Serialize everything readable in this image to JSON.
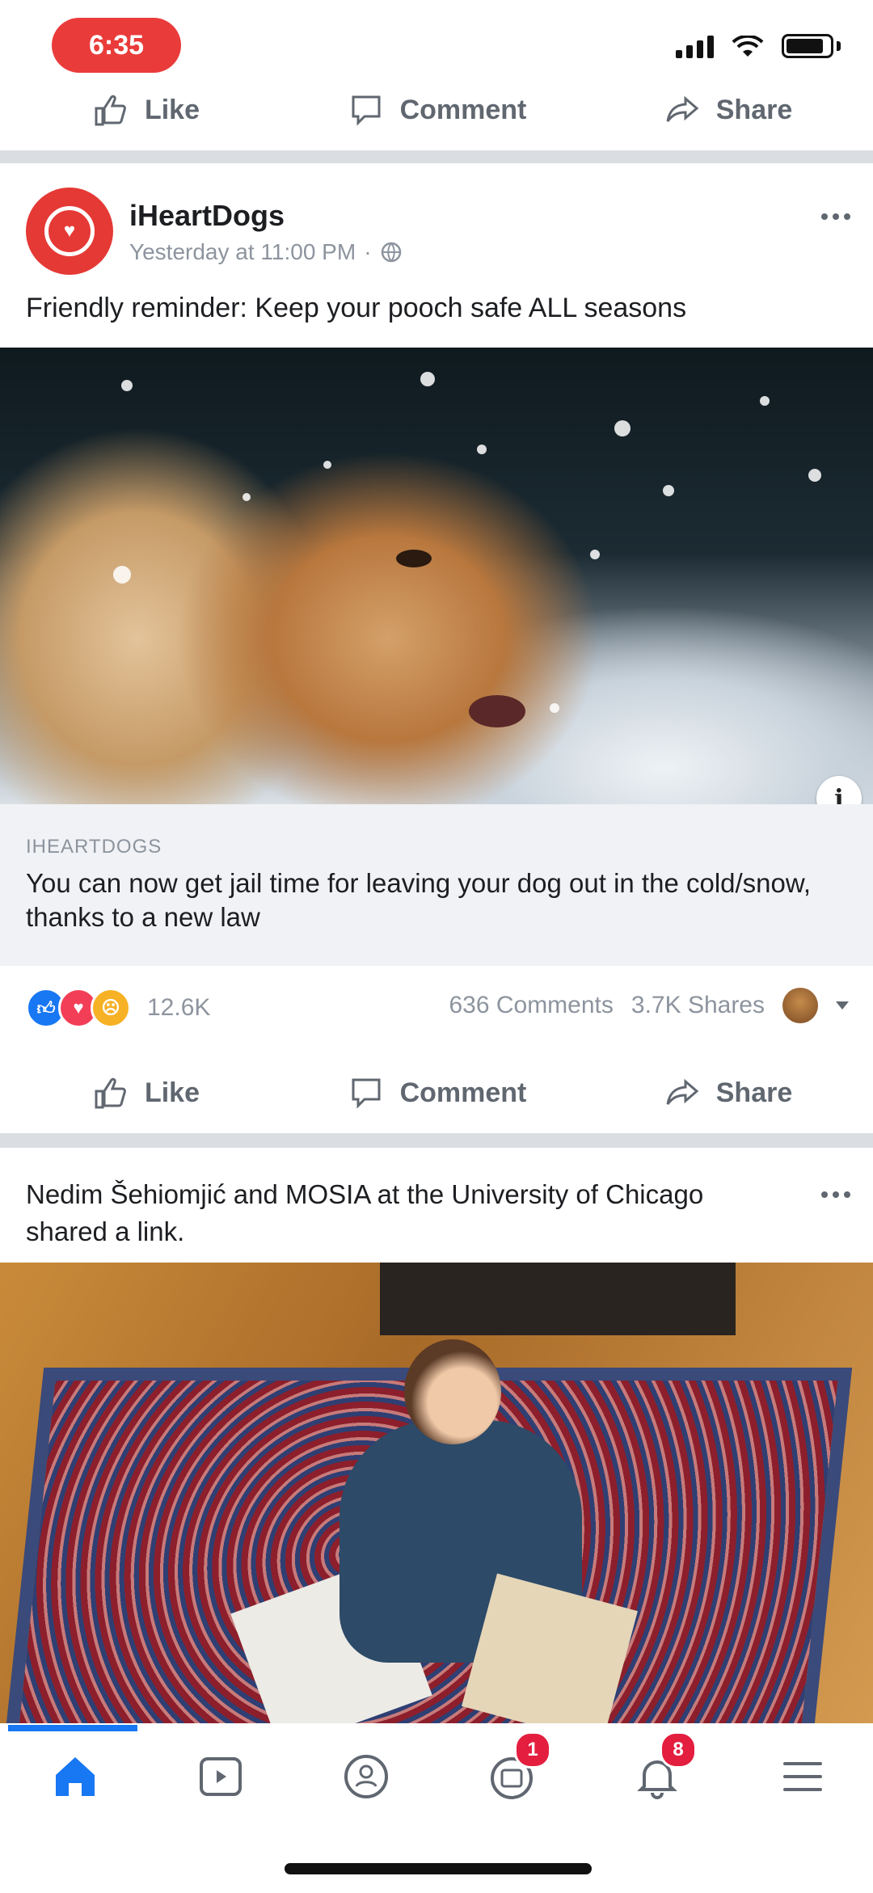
{
  "status_bar": {
    "time": "6:35"
  },
  "top_actions": {
    "like": "Like",
    "comment": "Comment",
    "share": "Share"
  },
  "post1": {
    "author": "iHeartDogs",
    "timestamp": "Yesterday at 11:00 PM",
    "text": "Friendly reminder: Keep your pooch safe ALL seasons",
    "link": {
      "domain": "IHEARTDOGS",
      "title": "You can now get jail time for leaving your dog out in the cold/snow, thanks to a new law"
    },
    "reactions_count": "12.6K",
    "comments": "636 Comments",
    "shares": "3.7K Shares",
    "actions": {
      "like": "Like",
      "comment": "Comment",
      "share": "Share"
    }
  },
  "post2": {
    "shared_text": "Nedim Šehiomjić and MOSIA at the University of Chicago shared a link."
  },
  "nav": {
    "notifications_badge": "1",
    "messages_badge": "8"
  },
  "colors": {
    "brand_blue": "#1877f2",
    "badge_red": "#e41e3f",
    "time_pill": "#ea3b3b"
  }
}
